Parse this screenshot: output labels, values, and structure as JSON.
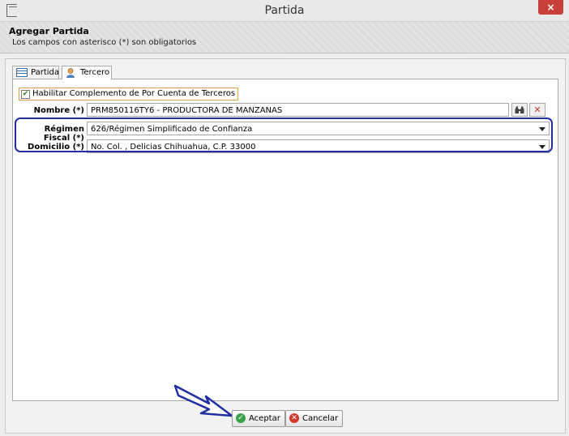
{
  "window": {
    "title": "Partida",
    "close_label": "×"
  },
  "header": {
    "title": "Agregar Partida",
    "subtitle": "Los campos con asterisco (*) son obligatorios"
  },
  "tabs": [
    {
      "label": "Partida",
      "icon": "table-icon",
      "active": false
    },
    {
      "label": "Tercero",
      "icon": "person-icon",
      "active": true
    }
  ],
  "form": {
    "checkbox": {
      "label": "Habilitar Complemento de Por Cuenta de Terceros",
      "checked": true
    },
    "nombre": {
      "label": "Nombre (*)",
      "value": "PRM850116TY6 - PRODUCTORA DE MANZANAS"
    },
    "regimen": {
      "label": "Régimen Fiscal (*)",
      "value": "626/Régimen Simplificado de Confianza"
    },
    "domicilio": {
      "label": "Domicilio (*)",
      "value": "No.  Col. , Delicias Chihuahua, C.P. 33000"
    }
  },
  "buttons": {
    "accept": "Aceptar",
    "cancel": "Cancelar"
  },
  "colors": {
    "highlight": "#1f2fa3",
    "close": "#c7413a",
    "accept_icon": "#3aa34a",
    "cancel_icon": "#d33a2f"
  }
}
